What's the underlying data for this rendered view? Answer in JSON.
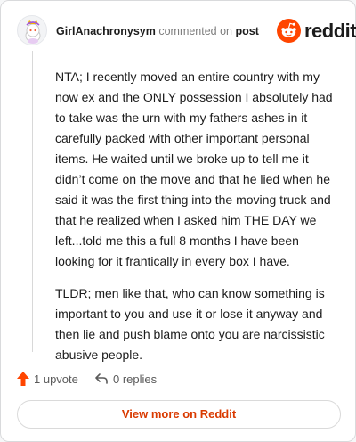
{
  "comment": {
    "author": "GirlAnachronysym",
    "action_text": "commented on",
    "target_text": "post",
    "paragraphs": [
      "NTA; I recently moved an entire country with my now ex and the ONLY possession I absolutely had to take was the urn with my fathers ashes in it carefully packed with other important personal items. He waited until we broke up to tell me it didn’t come on the move and that he lied when he said it was the first thing into the moving truck and that he realized when I asked him THE DAY we left...told me this a full 8 months I have been looking for it frantically in every box I have.",
      "TLDR; men like that, who can know something is important to you and use it or lose it anyway and then lie and push blame onto you are narcissistic abusive people."
    ]
  },
  "brand": {
    "wordmark": "reddit",
    "icon": "reddit-snoo-icon",
    "color": "#ff4500"
  },
  "actions": {
    "upvote_label": "1 upvote",
    "upvote_icon": "upvote-arrow-icon",
    "upvote_color": "#ff4500",
    "replies_label": "0 replies",
    "replies_icon": "reply-arrow-icon"
  },
  "cta": {
    "label": "View more on Reddit",
    "color": "#d93a00"
  },
  "avatar": {
    "icon": "snoo-avatar-icon"
  }
}
